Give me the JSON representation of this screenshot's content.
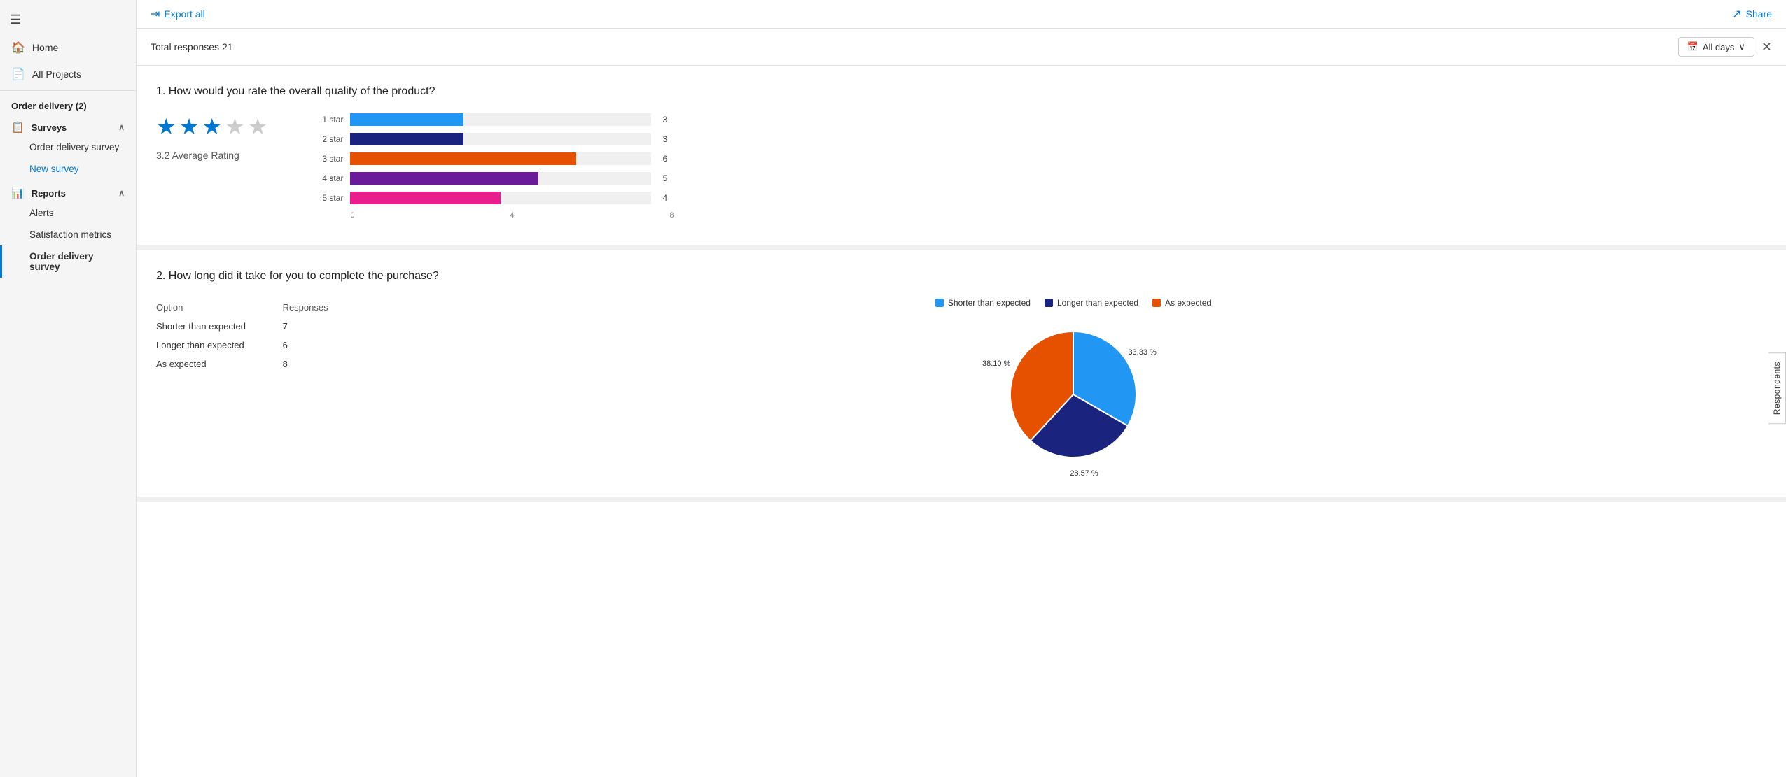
{
  "sidebar": {
    "hamburger_icon": "☰",
    "nav_items": [
      {
        "label": "Home",
        "icon": "🏠"
      },
      {
        "label": "All Projects",
        "icon": "📄"
      }
    ],
    "section_order_delivery": {
      "title": "Order delivery (2)",
      "surveys_label": "Surveys",
      "surveys_items": [
        {
          "label": "Order delivery survey",
          "active": false
        },
        {
          "label": "New survey",
          "active_blue": true
        }
      ],
      "reports_label": "Reports",
      "reports_items": [
        {
          "label": "Alerts",
          "active": false
        },
        {
          "label": "Satisfaction metrics",
          "active": false
        },
        {
          "label": "Order delivery survey",
          "active_bold": true
        }
      ]
    }
  },
  "toolbar": {
    "export_label": "Export all",
    "share_label": "Share"
  },
  "subheader": {
    "total_responses": "Total responses 21",
    "filter_label": "All days"
  },
  "q1": {
    "number": "1.",
    "text": "How would you rate the overall quality of the product?",
    "avg_rating": "3.2 Average Rating",
    "stars_filled": 3,
    "stars_empty": 2,
    "bars": [
      {
        "label": "1 star",
        "value": 3,
        "max": 8,
        "color": "#2196f3"
      },
      {
        "label": "2 star",
        "value": 3,
        "max": 8,
        "color": "#1a237e"
      },
      {
        "label": "3 star",
        "value": 6,
        "max": 8,
        "color": "#e65100"
      },
      {
        "label": "4 star",
        "value": 5,
        "max": 8,
        "color": "#6a1b9a"
      },
      {
        "label": "5 star",
        "value": 4,
        "max": 8,
        "color": "#e91e8c"
      }
    ],
    "axis_labels": [
      "0",
      "4",
      "8"
    ]
  },
  "q2": {
    "number": "2.",
    "text": "How long did it take for you to complete the purchase?",
    "table_headers": [
      "Option",
      "Responses"
    ],
    "table_rows": [
      {
        "option": "Shorter than expected",
        "responses": "7"
      },
      {
        "option": "Longer than expected",
        "responses": "6"
      },
      {
        "option": "As expected",
        "responses": "8"
      }
    ],
    "pie": {
      "segments": [
        {
          "label": "Shorter than expected",
          "percent": 33.33,
          "color": "#2196f3",
          "text": "33.33 %"
        },
        {
          "label": "Longer than expected",
          "percent": 28.57,
          "color": "#1a237e",
          "text": "28.57 %"
        },
        {
          "label": "As expected",
          "percent": 38.1,
          "color": "#e65100",
          "text": "38.10 %"
        }
      ]
    }
  },
  "respondents_tab": "Respondents"
}
